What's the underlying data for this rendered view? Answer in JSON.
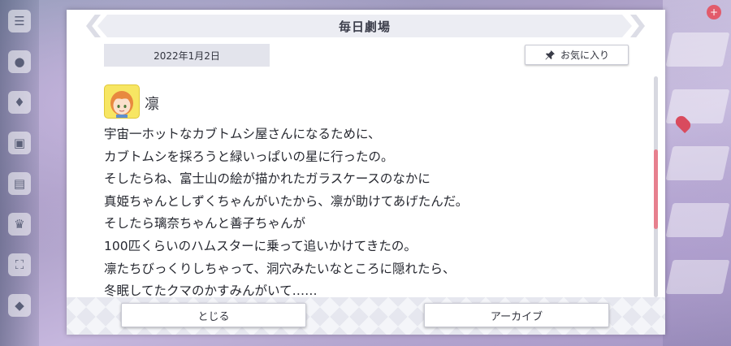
{
  "dialog": {
    "title": "毎日劇場",
    "date": "2022年1月2日",
    "favorite_label": "お気に入り",
    "speaker": {
      "name": "凛",
      "avatar_icon": "rin-avatar-icon"
    },
    "lines": [
      "宇宙一ホットなカブトムシ屋さんになるために、",
      "カブトムシを採ろうと緑いっぱいの星に行ったの。",
      "そしたらね、富士山の絵が描かれたガラスケースのなかに",
      "真姫ちゃんとしずくちゃんがいたから、凛が助けてあげたんだ。",
      "そしたら璃奈ちゃんと善子ちゃんが",
      "100匹くらいのハムスターに乗って追いかけてきたの。",
      "凛たちびっくりしちゃって、洞穴みたいなところに隠れたら、",
      "冬眠してたクマのかすみんがいて……"
    ],
    "close_label": "とじる",
    "archive_label": "アーカイブ",
    "scroll_position": 0.52
  },
  "colors": {
    "scroll_thumb": "#e7808e",
    "avatar_bg": "#f7e663",
    "title_bar": "#ecedf3"
  }
}
